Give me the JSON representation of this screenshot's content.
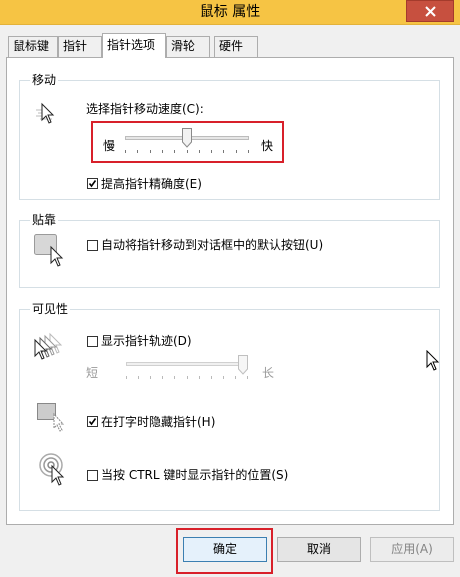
{
  "window": {
    "title": "鼠标 属性",
    "close_icon": "close-icon"
  },
  "tabs": [
    {
      "label": "鼠标键",
      "active": false
    },
    {
      "label": "指针",
      "active": false
    },
    {
      "label": "指针选项",
      "active": true
    },
    {
      "label": "滑轮",
      "active": false
    },
    {
      "label": "硬件",
      "active": false
    }
  ],
  "motion": {
    "group_title": "移动",
    "speed_label": "选择指针移动速度(C):",
    "slow_label": "慢",
    "fast_label": "快",
    "speed_level": 0.5,
    "precision_label": "提高指针精确度(E)",
    "precision_checked": true
  },
  "snap": {
    "group_title": "贴靠",
    "snap_label": "自动将指针移动到对话框中的默认按钮(U)",
    "snap_checked": false
  },
  "visibility": {
    "group_title": "可见性",
    "trails_label": "显示指针轨迹(D)",
    "trails_checked": false,
    "short_label": "短",
    "long_label": "长",
    "trail_length_level": 1.0,
    "hide_label": "在打字时隐藏指针(H)",
    "hide_checked": true,
    "ctrl_label": "当按 CTRL 键时显示指针的位置(S)",
    "ctrl_checked": false
  },
  "buttons": {
    "ok": "确定",
    "cancel": "取消",
    "apply": "应用(A)"
  },
  "colors": {
    "titlebar": "#f6c444",
    "close": "#c7503f",
    "highlight": "#d8202a"
  }
}
